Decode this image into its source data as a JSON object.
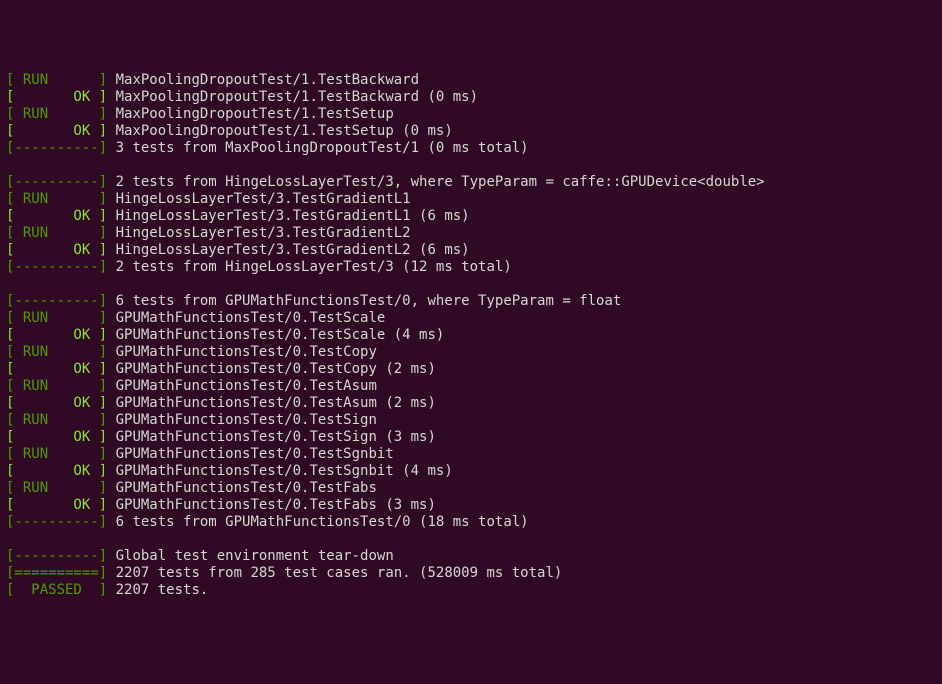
{
  "lines": [
    {
      "tag": "RUN",
      "color": "g",
      "text": "MaxPoolingDropoutTest/1.TestBackward"
    },
    {
      "tag": "OK",
      "color": "lg",
      "text": "MaxPoolingDropoutTest/1.TestBackward (0 ms)"
    },
    {
      "tag": "RUN",
      "color": "g",
      "text": "MaxPoolingDropoutTest/1.TestSetup"
    },
    {
      "tag": "OK",
      "color": "lg",
      "text": "MaxPoolingDropoutTest/1.TestSetup (0 ms)"
    },
    {
      "tag": "DASH",
      "color": "g",
      "text": "3 tests from MaxPoolingDropoutTest/1 (0 ms total)"
    },
    {
      "tag": "BLANK"
    },
    {
      "tag": "DASH",
      "color": "g",
      "text": "2 tests from HingeLossLayerTest/3, where TypeParam = caffe::GPUDevice<double>"
    },
    {
      "tag": "RUN",
      "color": "g",
      "text": "HingeLossLayerTest/3.TestGradientL1"
    },
    {
      "tag": "OK",
      "color": "lg",
      "text": "HingeLossLayerTest/3.TestGradientL1 (6 ms)"
    },
    {
      "tag": "RUN",
      "color": "g",
      "text": "HingeLossLayerTest/3.TestGradientL2"
    },
    {
      "tag": "OK",
      "color": "lg",
      "text": "HingeLossLayerTest/3.TestGradientL2 (6 ms)"
    },
    {
      "tag": "DASH",
      "color": "g",
      "text": "2 tests from HingeLossLayerTest/3 (12 ms total)"
    },
    {
      "tag": "BLANK"
    },
    {
      "tag": "DASH",
      "color": "g",
      "text": "6 tests from GPUMathFunctionsTest/0, where TypeParam = float"
    },
    {
      "tag": "RUN",
      "color": "g",
      "text": "GPUMathFunctionsTest/0.TestScale"
    },
    {
      "tag": "OK",
      "color": "lg",
      "text": "GPUMathFunctionsTest/0.TestScale (4 ms)"
    },
    {
      "tag": "RUN",
      "color": "g",
      "text": "GPUMathFunctionsTest/0.TestCopy"
    },
    {
      "tag": "OK",
      "color": "lg",
      "text": "GPUMathFunctionsTest/0.TestCopy (2 ms)"
    },
    {
      "tag": "RUN",
      "color": "g",
      "text": "GPUMathFunctionsTest/0.TestAsum"
    },
    {
      "tag": "OK",
      "color": "lg",
      "text": "GPUMathFunctionsTest/0.TestAsum (2 ms)"
    },
    {
      "tag": "RUN",
      "color": "g",
      "text": "GPUMathFunctionsTest/0.TestSign"
    },
    {
      "tag": "OK",
      "color": "lg",
      "text": "GPUMathFunctionsTest/0.TestSign (3 ms)"
    },
    {
      "tag": "RUN",
      "color": "g",
      "text": "GPUMathFunctionsTest/0.TestSgnbit"
    },
    {
      "tag": "OK",
      "color": "lg",
      "text": "GPUMathFunctionsTest/0.TestSgnbit (4 ms)"
    },
    {
      "tag": "RUN",
      "color": "g",
      "text": "GPUMathFunctionsTest/0.TestFabs"
    },
    {
      "tag": "OK",
      "color": "lg",
      "text": "GPUMathFunctionsTest/0.TestFabs (3 ms)"
    },
    {
      "tag": "DASH",
      "color": "g",
      "text": "6 tests from GPUMathFunctionsTest/0 (18 ms total)"
    },
    {
      "tag": "BLANK"
    },
    {
      "tag": "DASH",
      "color": "g",
      "text": "Global test environment tear-down"
    },
    {
      "tag": "EQ",
      "color": "g",
      "text": "2207 tests from 285 test cases ran. (528009 ms total)"
    },
    {
      "tag": "PASSED",
      "color": "g",
      "text": "2207 tests."
    }
  ],
  "tags": {
    "RUN": "[ RUN      ]",
    "OK": "[       OK ]",
    "DASH": "[----------]",
    "EQ": "[==========]",
    "PASSED": "[  PASSED  ]"
  }
}
